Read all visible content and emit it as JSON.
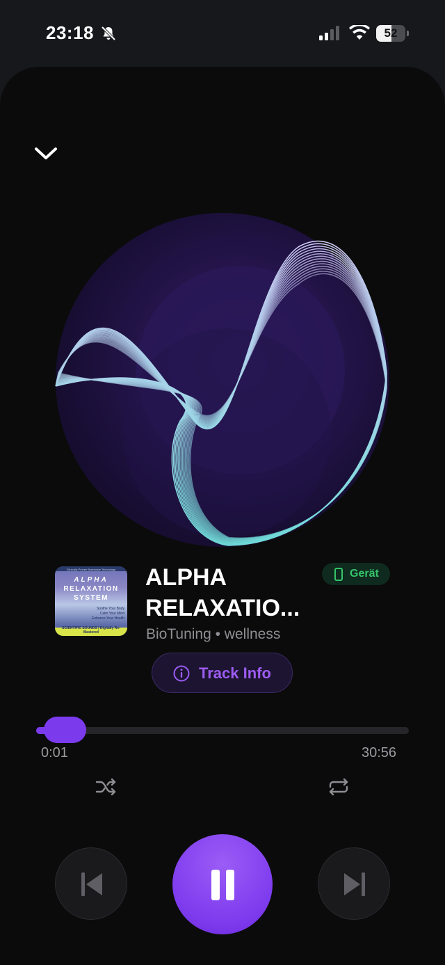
{
  "status_bar": {
    "time": "23:18",
    "battery_level": "52",
    "icons": [
      "bell-slash-icon",
      "cellular-signal-icon",
      "wifi-icon",
      "battery-icon"
    ]
  },
  "player": {
    "collapse_icon": "chevron-down-icon",
    "album_art": {
      "title": "ALPHA",
      "title2": "RELAXATION",
      "title3": "SYSTEM",
      "header": "Clinically Proven Brainwave Technology",
      "blurb_1": "Soothe Your Body",
      "blurb_2": "Calm Your Mind",
      "blurb_3": "Enhance Your Health",
      "footer": "SCIENTIFIC SOUNDS | Digitally Re-Mastered"
    },
    "track_title": "ALPHA RELAXATIO...",
    "artist_line": "BioTuning • wellness",
    "device_badge": "Gerät",
    "track_info_label": "Track Info",
    "elapsed": "0:01",
    "duration": "30:56",
    "progress": 0.02,
    "is_playing": true,
    "accent_color": "#7c3aed",
    "device_color": "#35c46b"
  }
}
